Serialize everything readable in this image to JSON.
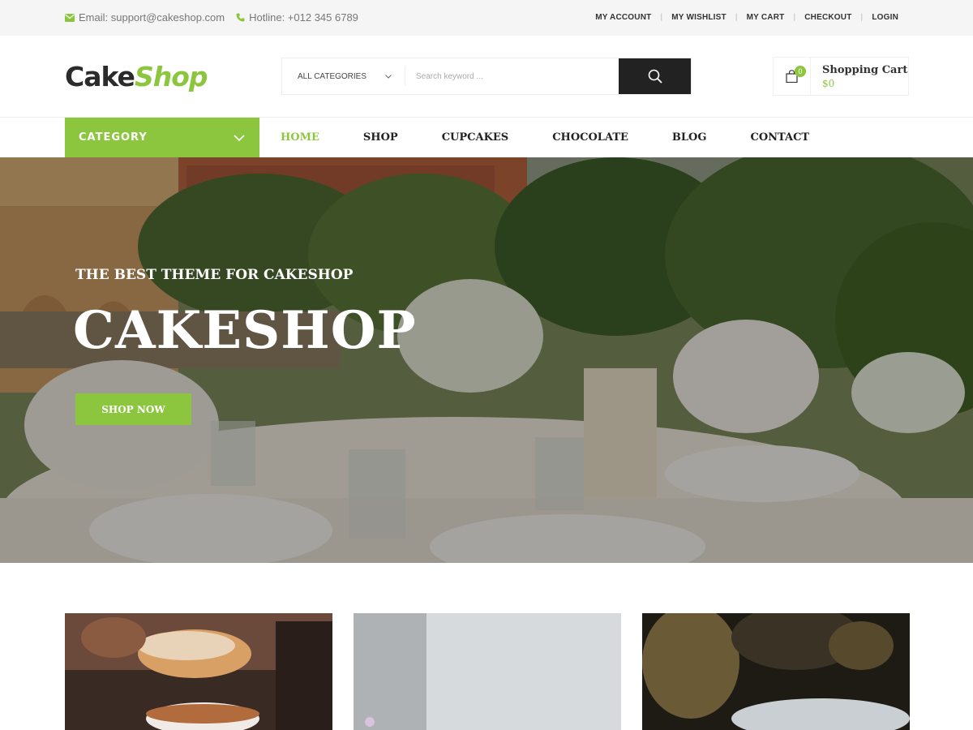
{
  "topbar": {
    "email": "Email: support@cakeshop.com",
    "hotline": "Hotline: +012 345 6789",
    "links": [
      "MY ACCOUNT",
      "MY WISHLIST",
      "MY CART",
      "CHECKOUT",
      "LOGIN"
    ]
  },
  "header": {
    "logo_part1": "Cake",
    "logo_part2": "Shop",
    "search": {
      "category_label": "ALL CATEGORIES",
      "placeholder": "Search keyword ..."
    },
    "cart": {
      "title": "Shopping Cart",
      "total": "$0",
      "count": "0"
    }
  },
  "nav": {
    "category_label": "CATEGORY",
    "items": [
      "HOME",
      "SHOP",
      "CUPCAKES",
      "CHOCOLATE",
      "BLOG",
      "CONTACT"
    ],
    "active": "HOME"
  },
  "hero": {
    "subtitle": "THE BEST THEME FOR CAKESHOP",
    "title": "CAKESHOP",
    "button": "SHOP NOW"
  },
  "colors": {
    "accent": "#8cc63f",
    "dark": "#222222",
    "topbar_bg": "#f5f5f5"
  },
  "icons": {
    "email": "envelope-icon",
    "phone": "phone-icon",
    "search": "search-icon",
    "dropdown": "chevron-down-icon",
    "cart": "shopping-bag-icon"
  }
}
